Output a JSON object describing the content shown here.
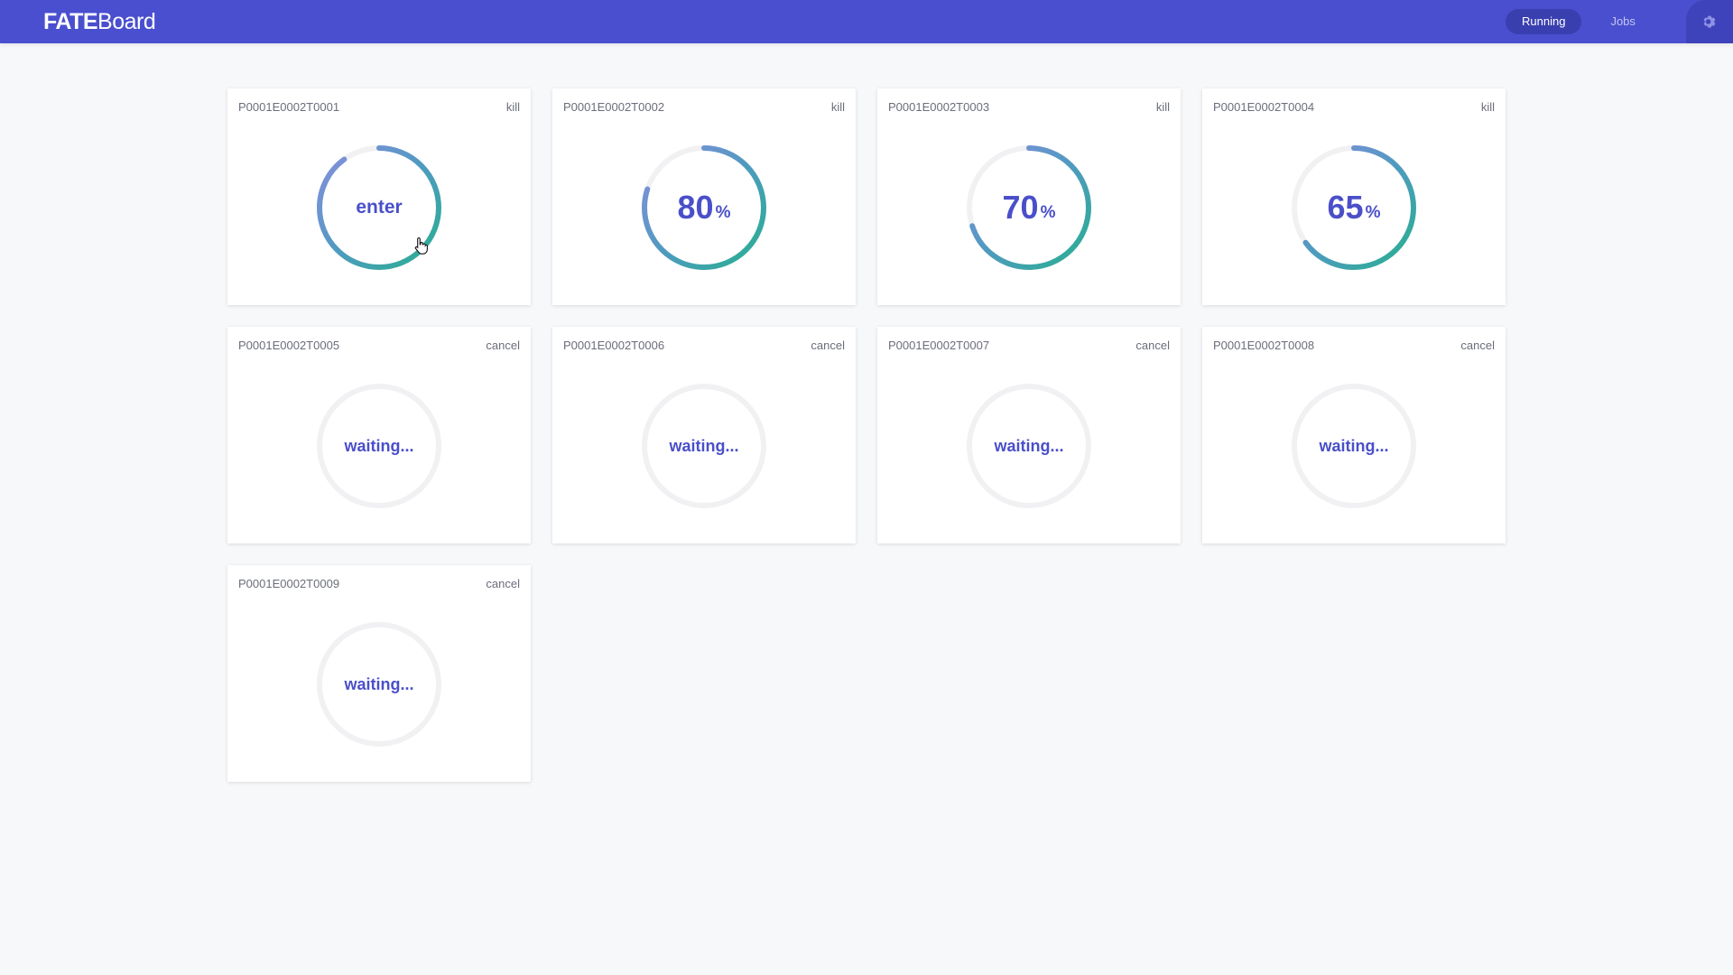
{
  "header": {
    "logo_bold": "FATE",
    "logo_light": "Board",
    "tabs": [
      {
        "label": "Running",
        "active": true
      },
      {
        "label": "Jobs",
        "active": false
      }
    ],
    "settings_icon": "gear-icon"
  },
  "colors": {
    "header_bg": "#494fce",
    "accent_text": "#4a4fc9",
    "ring_track": "#f1f1f3",
    "gradient_start": "#8a8ee0",
    "gradient_mid": "#4f9ac0",
    "gradient_end": "#27b08f"
  },
  "cards": [
    {
      "id": "P0001E0002T0001",
      "action": "kill",
      "status": "running",
      "progress": 90,
      "label": "enter"
    },
    {
      "id": "P0001E0002T0002",
      "action": "kill",
      "status": "running",
      "progress": 80,
      "label": "80",
      "unit": "%"
    },
    {
      "id": "P0001E0002T0003",
      "action": "kill",
      "status": "running",
      "progress": 70,
      "label": "70",
      "unit": "%"
    },
    {
      "id": "P0001E0002T0004",
      "action": "kill",
      "status": "running",
      "progress": 65,
      "label": "65",
      "unit": "%"
    },
    {
      "id": "P0001E0002T0005",
      "action": "cancel",
      "status": "waiting",
      "progress": 0,
      "label": "waiting..."
    },
    {
      "id": "P0001E0002T0006",
      "action": "cancel",
      "status": "waiting",
      "progress": 0,
      "label": "waiting..."
    },
    {
      "id": "P0001E0002T0007",
      "action": "cancel",
      "status": "waiting",
      "progress": 0,
      "label": "waiting..."
    },
    {
      "id": "P0001E0002T0008",
      "action": "cancel",
      "status": "waiting",
      "progress": 0,
      "label": "waiting..."
    },
    {
      "id": "P0001E0002T0009",
      "action": "cancel",
      "status": "waiting",
      "progress": 0,
      "label": "waiting..."
    }
  ]
}
